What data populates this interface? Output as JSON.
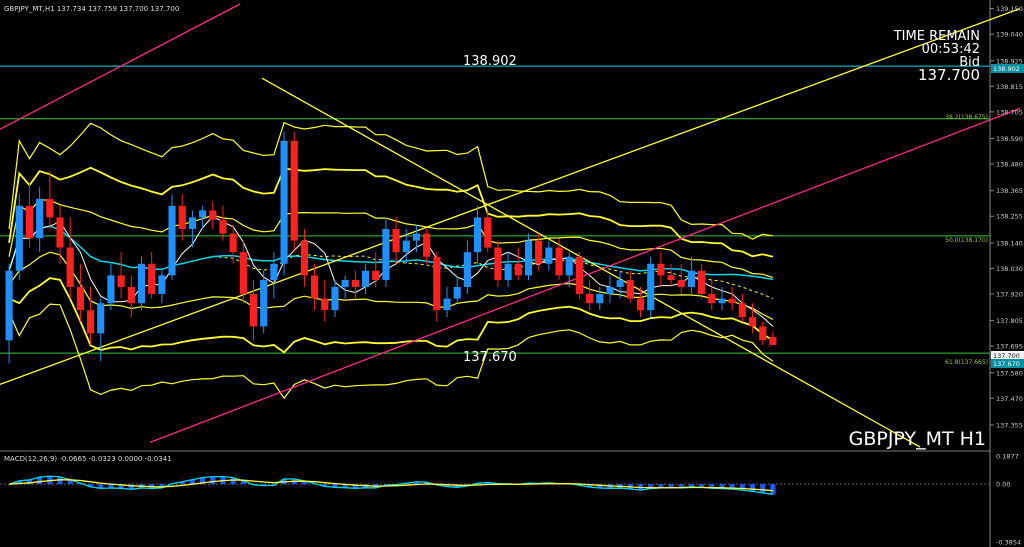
{
  "header": {
    "main_label": "GBPJPY_MT,H1  137.734 137.759 137.700 137.700",
    "macd_label": "MACD(12,26,9) -0.0665 -0.0323 0.0000 -0.0341"
  },
  "overlay": {
    "time_remain_label": "TIME REMAIN",
    "time_remain_value": "00:53:42",
    "bid_label": "Bid",
    "bid_value": "137.700",
    "symbol_watermark": "GBPJPY_MT H1"
  },
  "annotations": [
    {
      "text": "138.902",
      "price": 138.902
    },
    {
      "text": "137.670",
      "price": 137.67
    }
  ],
  "fib_labels": [
    {
      "text": "38.2(138.675)",
      "price": 138.675
    },
    {
      "text": "50.0(138.170)",
      "price": 138.17
    },
    {
      "text": "61.8(137.665)",
      "price": 137.665
    }
  ],
  "price_tags": [
    {
      "text": "138.902",
      "price": 138.902
    },
    {
      "text": "137.700",
      "price": 137.7
    },
    {
      "text": "137.670",
      "price": 137.67
    }
  ],
  "colors": {
    "bull": "#1e90ff",
    "bear": "#ff2020",
    "band": "#ffff33",
    "ma": "#00d8e8",
    "fib": "#33cc33",
    "pink": "#ff2a8a",
    "axis_text": "#cccccc",
    "macd_hist": "#1e5aff",
    "macd_signal": "#ffff33"
  },
  "chart_data": [
    {
      "type": "candlestick",
      "symbol": "GBPJPY_MT",
      "timeframe": "H1",
      "ylim": [
        137.26,
        139.17
      ],
      "y_ticks": [
        "139.150",
        "139.040",
        "138.925",
        "138.815",
        "138.705",
        "138.590",
        "138.480",
        "138.365",
        "138.255",
        "138.140",
        "138.030",
        "137.920",
        "137.805",
        "137.695",
        "137.580",
        "137.470",
        "137.355"
      ],
      "horizontal_lines": [
        138.902,
        138.675,
        138.17,
        137.665
      ],
      "candles": [
        {
          "o": 137.72,
          "h": 138.05,
          "l": 137.62,
          "c": 138.02
        },
        {
          "o": 138.02,
          "h": 138.35,
          "l": 137.98,
          "c": 138.3
        },
        {
          "o": 138.3,
          "h": 138.4,
          "l": 138.12,
          "c": 138.16
        },
        {
          "o": 138.16,
          "h": 138.38,
          "l": 138.1,
          "c": 138.33
        },
        {
          "o": 138.33,
          "h": 138.45,
          "l": 138.2,
          "c": 138.25
        },
        {
          "o": 138.25,
          "h": 138.3,
          "l": 138.05,
          "c": 138.12
        },
        {
          "o": 138.12,
          "h": 138.25,
          "l": 137.9,
          "c": 137.95
        },
        {
          "o": 137.95,
          "h": 138.05,
          "l": 137.8,
          "c": 137.85
        },
        {
          "o": 137.85,
          "h": 137.95,
          "l": 137.7,
          "c": 137.75
        },
        {
          "o": 137.75,
          "h": 137.9,
          "l": 137.63,
          "c": 137.88
        },
        {
          "o": 137.88,
          "h": 138.05,
          "l": 137.85,
          "c": 138.0
        },
        {
          "o": 138.0,
          "h": 138.1,
          "l": 137.9,
          "c": 137.95
        },
        {
          "o": 137.95,
          "h": 138.0,
          "l": 137.82,
          "c": 137.88
        },
        {
          "o": 137.88,
          "h": 138.08,
          "l": 137.85,
          "c": 138.05
        },
        {
          "o": 138.05,
          "h": 138.1,
          "l": 137.9,
          "c": 137.92
        },
        {
          "o": 137.92,
          "h": 138.02,
          "l": 137.88,
          "c": 138.0
        },
        {
          "o": 138.0,
          "h": 138.35,
          "l": 137.98,
          "c": 138.3
        },
        {
          "o": 138.3,
          "h": 138.35,
          "l": 138.15,
          "c": 138.2
        },
        {
          "o": 138.2,
          "h": 138.28,
          "l": 138.12,
          "c": 138.25
        },
        {
          "o": 138.25,
          "h": 138.3,
          "l": 138.2,
          "c": 138.28
        },
        {
          "o": 138.28,
          "h": 138.32,
          "l": 138.2,
          "c": 138.24
        },
        {
          "o": 138.24,
          "h": 138.3,
          "l": 138.15,
          "c": 138.18
        },
        {
          "o": 138.18,
          "h": 138.22,
          "l": 138.05,
          "c": 138.1
        },
        {
          "o": 138.1,
          "h": 138.15,
          "l": 137.88,
          "c": 137.92
        },
        {
          "o": 137.92,
          "h": 137.98,
          "l": 137.72,
          "c": 137.78
        },
        {
          "o": 137.78,
          "h": 138.02,
          "l": 137.75,
          "c": 137.98
        },
        {
          "o": 137.98,
          "h": 138.1,
          "l": 137.9,
          "c": 138.05
        },
        {
          "o": 138.05,
          "h": 138.62,
          "l": 138.0,
          "c": 138.58
        },
        {
          "o": 138.58,
          "h": 138.62,
          "l": 138.1,
          "c": 138.15
        },
        {
          "o": 138.15,
          "h": 138.2,
          "l": 137.95,
          "c": 138.0
        },
        {
          "o": 138.0,
          "h": 138.05,
          "l": 137.85,
          "c": 137.9
        },
        {
          "o": 137.9,
          "h": 137.98,
          "l": 137.8,
          "c": 137.85
        },
        {
          "o": 137.85,
          "h": 137.98,
          "l": 137.82,
          "c": 137.95
        },
        {
          "o": 137.95,
          "h": 138.0,
          "l": 137.9,
          "c": 137.98
        },
        {
          "o": 137.98,
          "h": 138.02,
          "l": 137.9,
          "c": 137.95
        },
        {
          "o": 137.95,
          "h": 138.05,
          "l": 137.92,
          "c": 138.02
        },
        {
          "o": 138.02,
          "h": 138.1,
          "l": 137.95,
          "c": 137.98
        },
        {
          "o": 137.98,
          "h": 138.25,
          "l": 137.95,
          "c": 138.2
        },
        {
          "o": 138.2,
          "h": 138.25,
          "l": 138.05,
          "c": 138.1
        },
        {
          "o": 138.1,
          "h": 138.2,
          "l": 138.05,
          "c": 138.15
        },
        {
          "o": 138.15,
          "h": 138.22,
          "l": 138.1,
          "c": 138.18
        },
        {
          "o": 138.18,
          "h": 138.2,
          "l": 138.05,
          "c": 138.08
        },
        {
          "o": 138.08,
          "h": 138.1,
          "l": 137.8,
          "c": 137.85
        },
        {
          "o": 137.85,
          "h": 137.95,
          "l": 137.82,
          "c": 137.9
        },
        {
          "o": 137.9,
          "h": 138.0,
          "l": 137.88,
          "c": 137.95
        },
        {
          "o": 137.95,
          "h": 138.15,
          "l": 137.92,
          "c": 138.1
        },
        {
          "o": 138.1,
          "h": 138.3,
          "l": 138.05,
          "c": 138.25
        },
        {
          "o": 138.25,
          "h": 138.28,
          "l": 138.1,
          "c": 138.12
        },
        {
          "o": 138.12,
          "h": 138.15,
          "l": 137.95,
          "c": 137.98
        },
        {
          "o": 137.98,
          "h": 138.1,
          "l": 137.95,
          "c": 138.05
        },
        {
          "o": 138.05,
          "h": 138.12,
          "l": 137.98,
          "c": 138.0
        },
        {
          "o": 138.0,
          "h": 138.18,
          "l": 137.98,
          "c": 138.15
        },
        {
          "o": 138.15,
          "h": 138.18,
          "l": 138.02,
          "c": 138.05
        },
        {
          "o": 138.05,
          "h": 138.15,
          "l": 138.02,
          "c": 138.12
        },
        {
          "o": 138.12,
          "h": 138.16,
          "l": 137.98,
          "c": 138.0
        },
        {
          "o": 138.0,
          "h": 138.1,
          "l": 137.95,
          "c": 138.08
        },
        {
          "o": 138.08,
          "h": 138.1,
          "l": 137.9,
          "c": 137.92
        },
        {
          "o": 137.92,
          "h": 137.98,
          "l": 137.85,
          "c": 137.88
        },
        {
          "o": 137.88,
          "h": 137.95,
          "l": 137.85,
          "c": 137.92
        },
        {
          "o": 137.92,
          "h": 138.0,
          "l": 137.88,
          "c": 137.95
        },
        {
          "o": 137.95,
          "h": 138.02,
          "l": 137.9,
          "c": 137.98
        },
        {
          "o": 137.98,
          "h": 138.02,
          "l": 137.88,
          "c": 137.9
        },
        {
          "o": 137.9,
          "h": 137.95,
          "l": 137.82,
          "c": 137.85
        },
        {
          "o": 137.85,
          "h": 138.08,
          "l": 137.82,
          "c": 138.05
        },
        {
          "o": 138.05,
          "h": 138.1,
          "l": 137.95,
          "c": 138.0
        },
        {
          "o": 138.0,
          "h": 138.05,
          "l": 137.95,
          "c": 137.98
        },
        {
          "o": 137.98,
          "h": 138.05,
          "l": 137.92,
          "c": 137.95
        },
        {
          "o": 137.95,
          "h": 138.08,
          "l": 137.92,
          "c": 138.02
        },
        {
          "o": 138.02,
          "h": 138.05,
          "l": 137.9,
          "c": 137.92
        },
        {
          "o": 137.92,
          "h": 137.98,
          "l": 137.85,
          "c": 137.88
        },
        {
          "o": 137.88,
          "h": 137.95,
          "l": 137.85,
          "c": 137.9
        },
        {
          "o": 137.9,
          "h": 137.95,
          "l": 137.85,
          "c": 137.88
        },
        {
          "o": 137.88,
          "h": 137.92,
          "l": 137.8,
          "c": 137.82
        },
        {
          "o": 137.82,
          "h": 137.88,
          "l": 137.75,
          "c": 137.78
        },
        {
          "o": 137.78,
          "h": 137.8,
          "l": 137.7,
          "c": 137.72
        },
        {
          "o": 137.734,
          "h": 137.759,
          "l": 137.7,
          "c": 137.7
        }
      ]
    },
    {
      "type": "bar",
      "indicator": "MACD(12,26,9)",
      "ylim": [
        -0.3854,
        0.1877
      ],
      "y_ticks": [
        "0.1877",
        "0.00",
        "-0.3854"
      ],
      "values": {
        "macd": -0.0665,
        "signal": -0.0323,
        "level": 0.0,
        "extra": -0.0341
      }
    }
  ]
}
